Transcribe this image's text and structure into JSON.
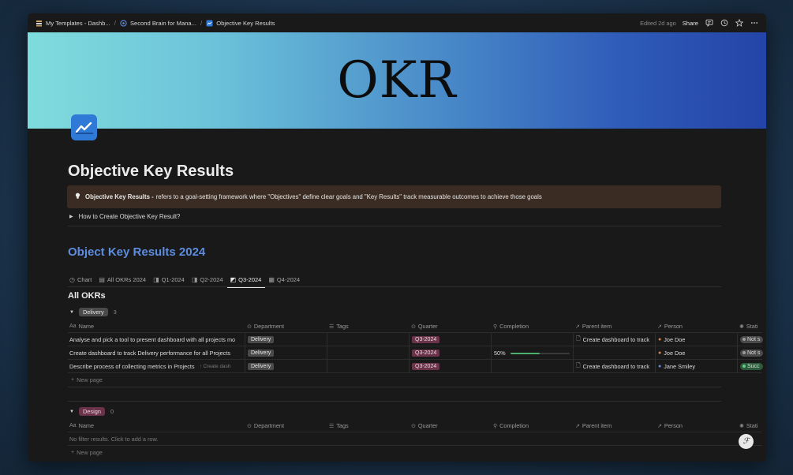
{
  "breadcrumbs": [
    {
      "label": "My Templates - Dashb..."
    },
    {
      "label": "Second Brain for Mana..."
    },
    {
      "label": "Objective Key Results"
    }
  ],
  "topbar": {
    "edited": "Edited 2d ago",
    "share": "Share"
  },
  "cover": {
    "title": "OKR"
  },
  "page": {
    "title": "Objective Key Results"
  },
  "callout": {
    "bold": "Objective Key Results -",
    "text": "refers to a goal-setting framework where \"Objectives\" define clear goals and \"Key Results\" track measurable outcomes to achieve those goals"
  },
  "toggle": {
    "label": "How to Create Objective Key Result?"
  },
  "section": {
    "title": "Object Key Results 2024"
  },
  "tabs": [
    {
      "label": "Chart",
      "icon": "clock-icon"
    },
    {
      "label": "All OKRs 2024",
      "icon": "table-icon"
    },
    {
      "label": "Q1-2024",
      "icon": "board-icon"
    },
    {
      "label": "Q2-2024",
      "icon": "board-icon"
    },
    {
      "label": "Q3-2024",
      "icon": "board-icon",
      "active": true
    },
    {
      "label": "Q4-2024",
      "icon": "board-icon"
    }
  ],
  "view": {
    "title": "All OKRs"
  },
  "columns": [
    "Name",
    "Department",
    "Tags",
    "Quarter",
    "Completion",
    "Parent item",
    "Person",
    "Stati"
  ],
  "column_prefix": "Aa",
  "groups": [
    {
      "name": "Delivery",
      "count": "3",
      "rows": [
        {
          "name": "Analyse and pick a tool to present dashboard with all projects mo",
          "sub": "",
          "department": "Delivery",
          "quarter": "Q3-2024",
          "completion": "",
          "progress": null,
          "parent": "Create dashboard to track",
          "person": "Joe Doe",
          "status": "Not s"
        },
        {
          "name": "Create dashboard to track Delivery performance for all Projects",
          "sub": "",
          "department": "Delivery",
          "quarter": "Q3-2024",
          "completion": "50%",
          "progress": 0.5,
          "parent": "",
          "person": "Joe Doe",
          "status": "Not s"
        },
        {
          "name": "Describe process of collecting metrics in Projects",
          "sub": "Create dash",
          "department": "Delivery",
          "quarter": "Q3-2024",
          "completion": "",
          "progress": null,
          "parent": "Create dashboard to track",
          "person": "Jane Smiley",
          "status": "Succ"
        }
      ],
      "new_page": "New page"
    },
    {
      "name": "Design",
      "count": "0",
      "empty_text": "No filter results. Click to add a row.",
      "new_page": "New page"
    }
  ],
  "colors": {
    "accent": "#5d8de0",
    "callout_bg": "#3a2c22",
    "q3_pill": "#6a3349",
    "success": "#2d5a3d"
  }
}
